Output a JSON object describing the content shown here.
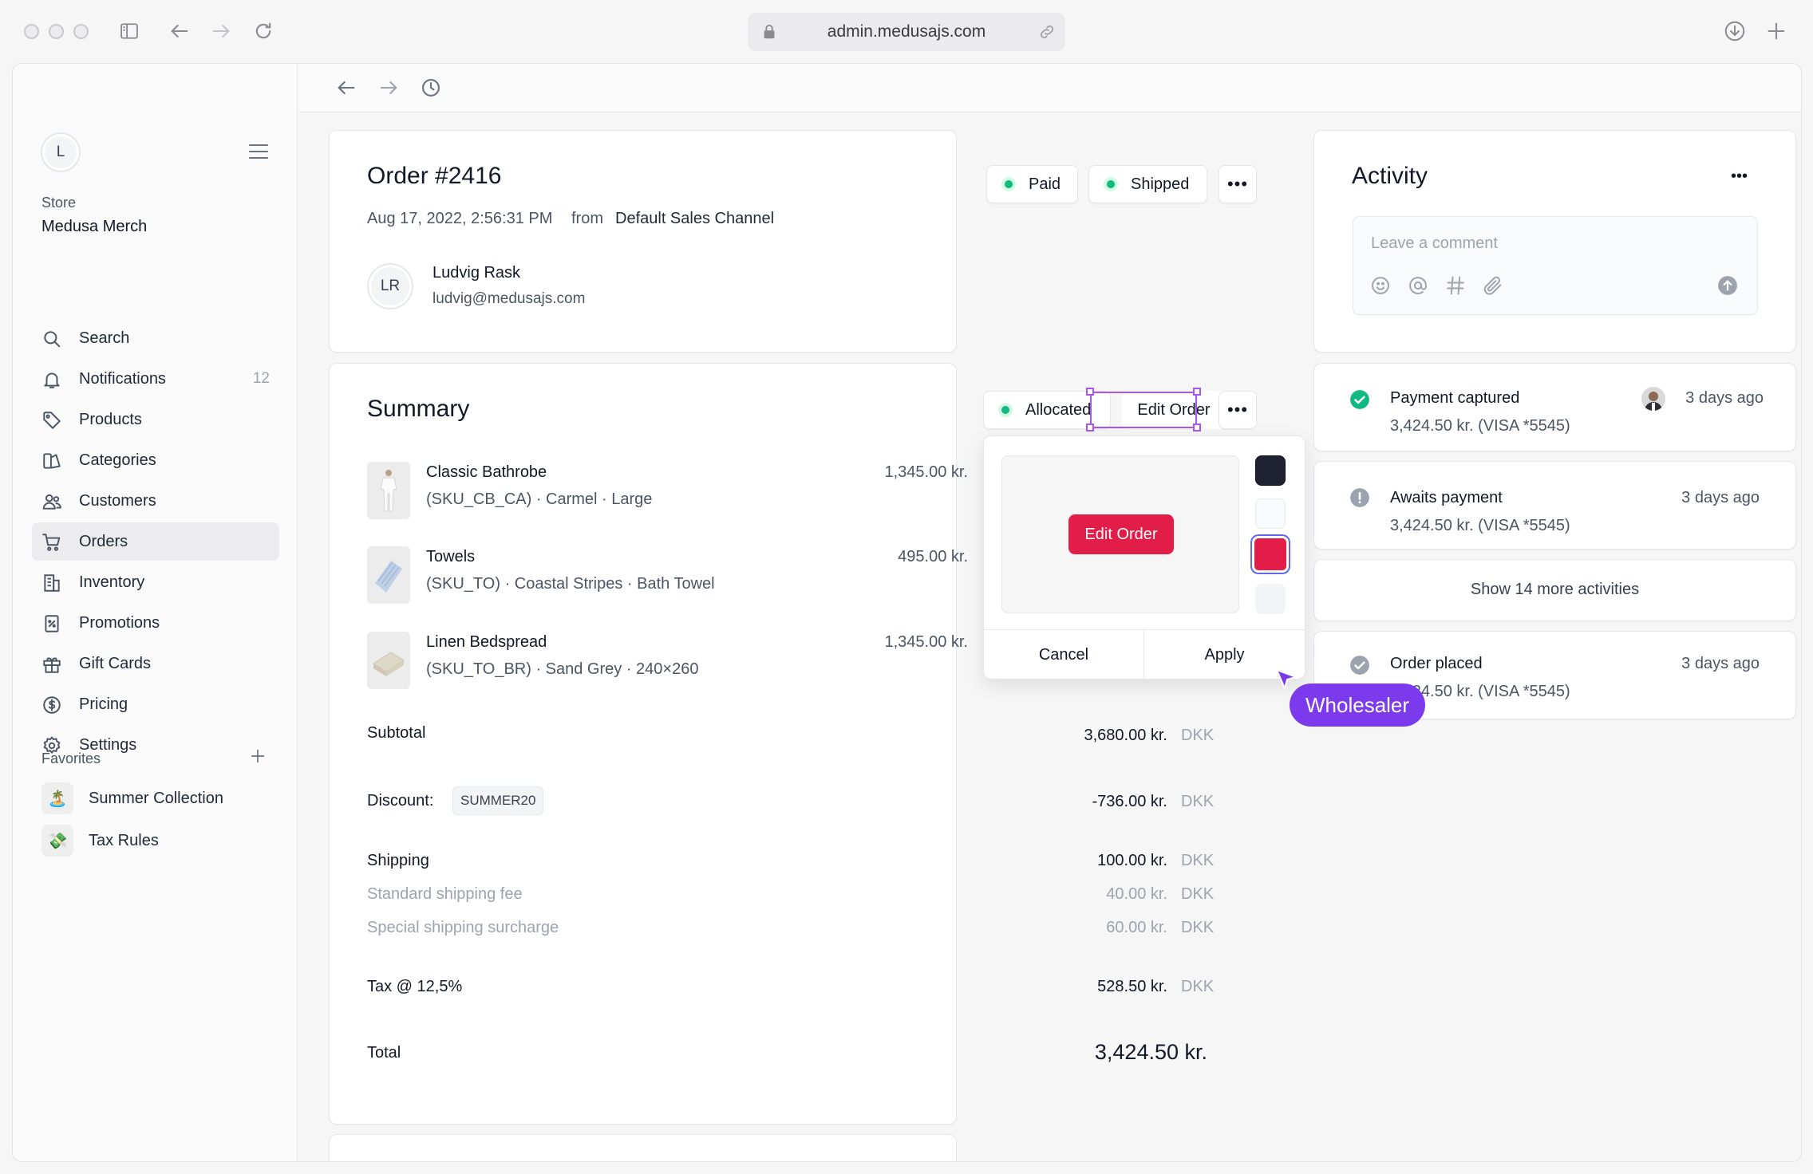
{
  "browser": {
    "url": "admin.medusajs.com"
  },
  "sidebar": {
    "avatar_initial": "L",
    "store_label": "Store",
    "store_name": "Medusa Merch",
    "nav": [
      {
        "label": "Search",
        "icon": "search-icon"
      },
      {
        "label": "Notifications",
        "icon": "bell-icon",
        "count": "12"
      },
      {
        "label": "Products",
        "icon": "tag-icon"
      },
      {
        "label": "Categories",
        "icon": "categories-icon"
      },
      {
        "label": "Customers",
        "icon": "users-icon"
      },
      {
        "label": "Orders",
        "icon": "cart-icon",
        "active": true
      },
      {
        "label": "Inventory",
        "icon": "building-icon"
      },
      {
        "label": "Promotions",
        "icon": "receipt-percent-icon"
      },
      {
        "label": "Gift Cards",
        "icon": "gift-icon"
      },
      {
        "label": "Pricing",
        "icon": "currency-dollar-icon"
      },
      {
        "label": "Settings",
        "icon": "gear-icon"
      }
    ],
    "favorites_title": "Favorites",
    "favorites": [
      {
        "label": "Summer Collection",
        "emoji": "🏝️"
      },
      {
        "label": "Tax Rules",
        "emoji": "💸"
      }
    ]
  },
  "order": {
    "title": "Order #2416",
    "date": "Aug 17, 2022, 2:56:31 PM",
    "from_word": "from",
    "channel": "Default Sales Channel",
    "status_paid": "Paid",
    "status_shipped": "Shipped",
    "customer_initials": "LR",
    "customer_name": "Ludvig Rask",
    "customer_email": "ludvig@medusajs.com"
  },
  "summary": {
    "title": "Summary",
    "allocated_label": "Allocated",
    "edit_label": "Edit Order",
    "items": [
      {
        "name": "Classic Bathrobe",
        "variant": "(SKU_CB_CA) · Carmel · Large",
        "price": "1,345.00 kr."
      },
      {
        "name": "Towels",
        "variant": "(SKU_TO) · Coastal Stripes · Bath Towel",
        "price": "495.00 kr."
      },
      {
        "name": "Linen Bedspread",
        "variant": "(SKU_TO_BR) · Sand Grey · 240×260",
        "price": "1,345.00 kr."
      }
    ],
    "subtotal_label": "Subtotal",
    "subtotal_value": "3,680.00 kr.",
    "currency": "DKK",
    "discount_label": "Discount:",
    "discount_code": "SUMMER20",
    "discount_value": "-736.00 kr.",
    "shipping_label": "Shipping",
    "shipping_value": "100.00 kr.",
    "shipping_std_label": "Standard shipping fee",
    "shipping_std_value": "40.00 kr.",
    "shipping_sur_label": "Special shipping surcharge",
    "shipping_sur_value": "60.00 kr.",
    "tax_label": "Tax @ 12,5%",
    "tax_value": "528.50 kr.",
    "total_label": "Total",
    "total_value": "3,424.50 kr."
  },
  "popover": {
    "preview_button": "Edit Order",
    "cancel": "Cancel",
    "apply": "Apply",
    "swatches": [
      "#1f2233",
      "#f9fafb",
      "#e11d48",
      "#f3f4f6"
    ],
    "selected_swatch": 2
  },
  "cursor": {
    "label": "Wholesaler",
    "color": "#7c3aed"
  },
  "activity": {
    "title": "Activity",
    "comment_placeholder": "Leave a comment",
    "events": [
      {
        "title": "Payment captured",
        "detail": "3,424.50 kr.  (VISA *5545)",
        "time": "3 days ago",
        "status": "success"
      },
      {
        "title": "Awaits payment",
        "detail": "3,424.50 kr.  (VISA *5545)",
        "time": "3 days ago",
        "status": "warning"
      },
      {
        "title": "Order placed",
        "detail": "3,424.50 kr.  (VISA *5545)",
        "time": "3 days ago",
        "status": "done"
      }
    ],
    "show_more": "Show 14 more activities"
  }
}
